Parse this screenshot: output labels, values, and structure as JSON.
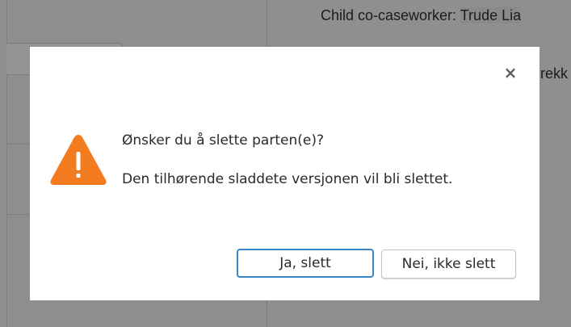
{
  "background": {
    "caseworker_line": "Child co-caseworker: ",
    "caseworker_name": "Trude Lia",
    "partial_text": "rekk"
  },
  "dialog": {
    "title": "Ønsker du å slette parten(e)?",
    "message": "Den tilhørende sladdete versjonen vil bli slettet.",
    "close_symbol": "×",
    "confirm_label": "Ja, slett",
    "cancel_label": "Nei, ikke slett",
    "icon": "warning-icon",
    "colors": {
      "warning": "#f47c20",
      "confirm_border": "#3a86c8",
      "overlay": "#8f8f8f"
    }
  }
}
